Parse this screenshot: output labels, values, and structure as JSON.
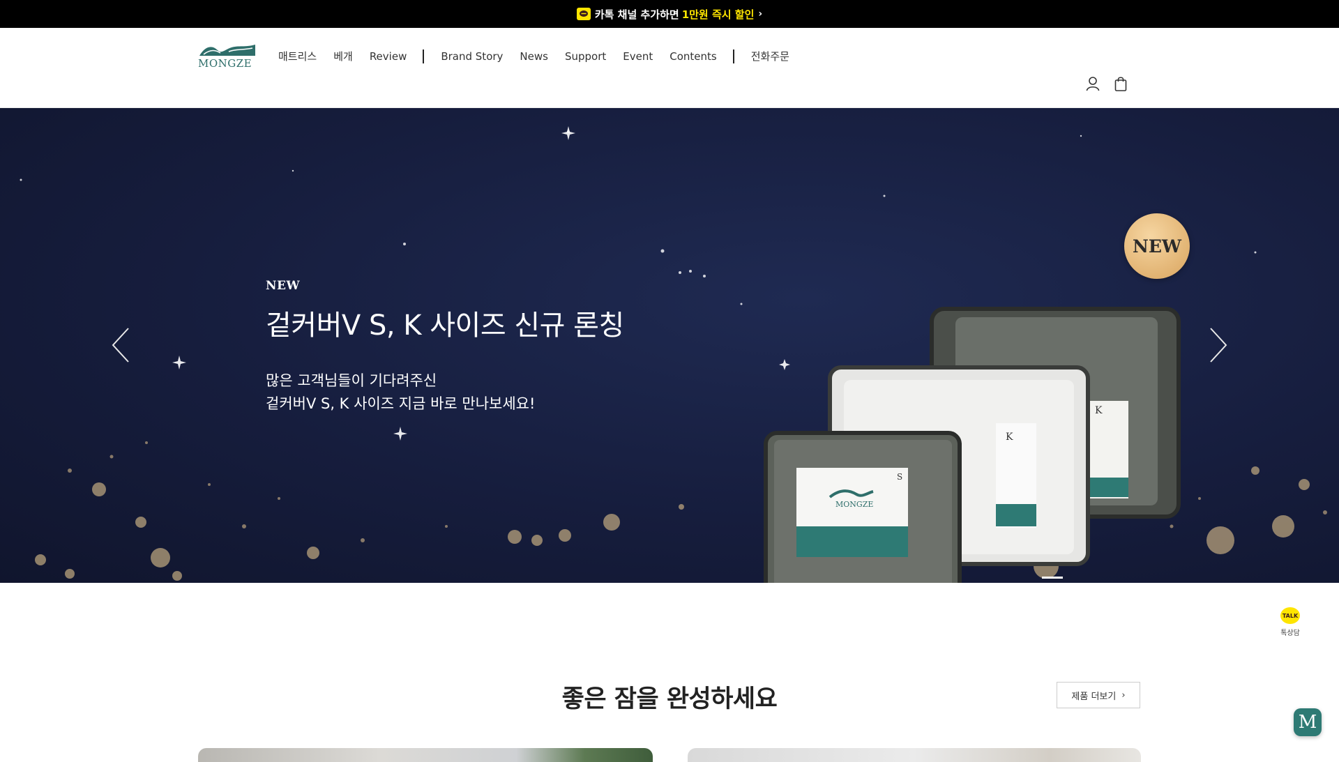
{
  "promo": {
    "text": "카톡 채널 추가하면",
    "highlight": "1만원 즉시 할인",
    "chevron": "›",
    "icon": "kakao-chat-icon"
  },
  "header": {
    "logo_text": "MONGZE",
    "nav": [
      {
        "label": "매트리스"
      },
      {
        "label": "베개"
      },
      {
        "label": "Review"
      },
      {
        "label": "Brand Story"
      },
      {
        "label": "News"
      },
      {
        "label": "Support"
      },
      {
        "label": "Event"
      },
      {
        "label": "Contents"
      },
      {
        "label": "전화주문"
      }
    ],
    "icons": [
      "user-icon",
      "shopping-bag-icon"
    ]
  },
  "hero": {
    "tag": "NEW",
    "title": "겉커버V S, K 사이즈 신규 론칭",
    "desc_line1": "많은 고객님들이 기다려주신",
    "desc_line2": "겉커버V S, K 사이즈 지금 바로 만나보세요!",
    "badge": "NEW",
    "product_label_s": "S",
    "product_label_k": "K",
    "product_brand": "MONGZE",
    "colors": {
      "background": "#161d3d",
      "badge": "#e2b06c",
      "teal": "#2e7a74"
    }
  },
  "section": {
    "title": "좋은 잠을 완성하세요",
    "more_button": "제품 더보기",
    "more_chevron": "›"
  },
  "floating": {
    "talk_badge": "TALK",
    "talk_label": "톡상담",
    "m_button": "M"
  }
}
